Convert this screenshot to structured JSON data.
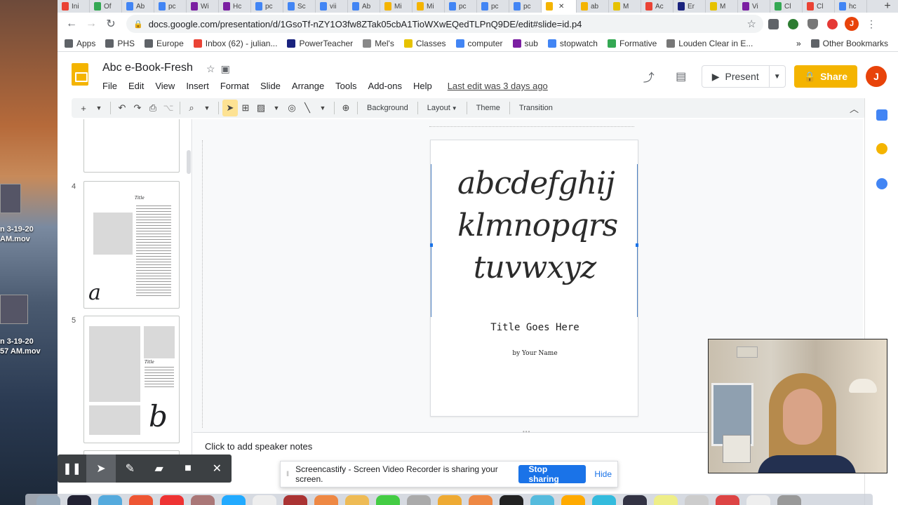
{
  "desktop": {
    "file1_line1": "n 3-19-20",
    "file1_line2": "AM.mov",
    "file2_line1": "n 3-19-20",
    "file2_line2": "57 AM.mov"
  },
  "browser": {
    "tabs": [
      {
        "label": "Ini",
        "color": "#ea4335"
      },
      {
        "label": "Of",
        "color": "#34a853"
      },
      {
        "label": "Ab",
        "color": "#4285f4"
      },
      {
        "label": "pc",
        "color": "#4285f4"
      },
      {
        "label": "Wi",
        "color": "#7b1fa2"
      },
      {
        "label": "Hc",
        "color": "#7b1fa2"
      },
      {
        "label": "pc",
        "color": "#4285f4"
      },
      {
        "label": "Sc",
        "color": "#4285f4"
      },
      {
        "label": "vii",
        "color": "#4285f4"
      },
      {
        "label": "Ab",
        "color": "#4285f4"
      },
      {
        "label": "Mi",
        "color": "#f4b400"
      },
      {
        "label": "Mi",
        "color": "#f4b400"
      },
      {
        "label": "pc",
        "color": "#4285f4"
      },
      {
        "label": "pc",
        "color": "#4285f4"
      },
      {
        "label": "pc",
        "color": "#4285f4"
      },
      {
        "label": "",
        "color": "#f4b400"
      },
      {
        "label": "ab",
        "color": "#f4b400"
      },
      {
        "label": "M",
        "color": "#e6c200"
      },
      {
        "label": "Ac",
        "color": "#ea4335"
      },
      {
        "label": "Er",
        "color": "#1a237e"
      },
      {
        "label": "M",
        "color": "#e6c200"
      },
      {
        "label": "Vi",
        "color": "#7b1fa2"
      },
      {
        "label": "Cl",
        "color": "#34a853"
      },
      {
        "label": "Cl",
        "color": "#ea4335"
      },
      {
        "label": "hc",
        "color": "#4285f4"
      }
    ],
    "url": "docs.google.com/presentation/d/1GsoTf-nZY1O3fw8ZTak05cbA1TioWXwEQedTLPnQ9DE/edit#slide=id.p4",
    "avatar_letter": "J",
    "bookmarks": [
      {
        "label": "Apps",
        "color": "#5f6368"
      },
      {
        "label": "PHS",
        "color": "#5f6368"
      },
      {
        "label": "Europe",
        "color": "#5f6368"
      },
      {
        "label": "Inbox (62) - julian...",
        "color": "#ea4335"
      },
      {
        "label": "PowerTeacher",
        "color": "#1a237e"
      },
      {
        "label": "Mel's",
        "color": "#888888"
      },
      {
        "label": "Classes",
        "color": "#e6c200"
      },
      {
        "label": "computer",
        "color": "#4285f4"
      },
      {
        "label": "sub",
        "color": "#7b1fa2"
      },
      {
        "label": "stopwatch",
        "color": "#4285f4"
      },
      {
        "label": "Formative",
        "color": "#34a853"
      },
      {
        "label": "Louden Clear in E...",
        "color": "#777777"
      }
    ],
    "more_bookmarks": "»",
    "other_bookmarks": "Other Bookmarks"
  },
  "app": {
    "doc_title": "Abc e-Book-Fresh",
    "menus": [
      "File",
      "Edit",
      "View",
      "Insert",
      "Format",
      "Slide",
      "Arrange",
      "Tools",
      "Add-ons",
      "Help"
    ],
    "last_edit": "Last edit was 3 days ago",
    "present_label": "Present",
    "share_label": "Share",
    "avatar_letter": "J",
    "toolbar": {
      "background": "Background",
      "layout": "Layout",
      "theme": "Theme",
      "transition": "Transition"
    }
  },
  "filmstrip": {
    "slides": [
      {
        "number": "4",
        "title": "Title",
        "letter": "a"
      },
      {
        "number": "5",
        "title": "Title",
        "letter": "b"
      }
    ]
  },
  "slide": {
    "alphabet_line1": "abcdefghij",
    "alphabet_line2": "klmnopqrs",
    "alphabet_line3": "tuvwxyz",
    "title": "Title Goes Here",
    "byline": "by Your Name"
  },
  "notes": {
    "placeholder": "Click to add speaker notes"
  },
  "recorder": {
    "banner_message": "Screencastify - Screen Video Recorder is sharing your screen.",
    "stop_label": "Stop sharing",
    "hide_label": "Hide"
  }
}
